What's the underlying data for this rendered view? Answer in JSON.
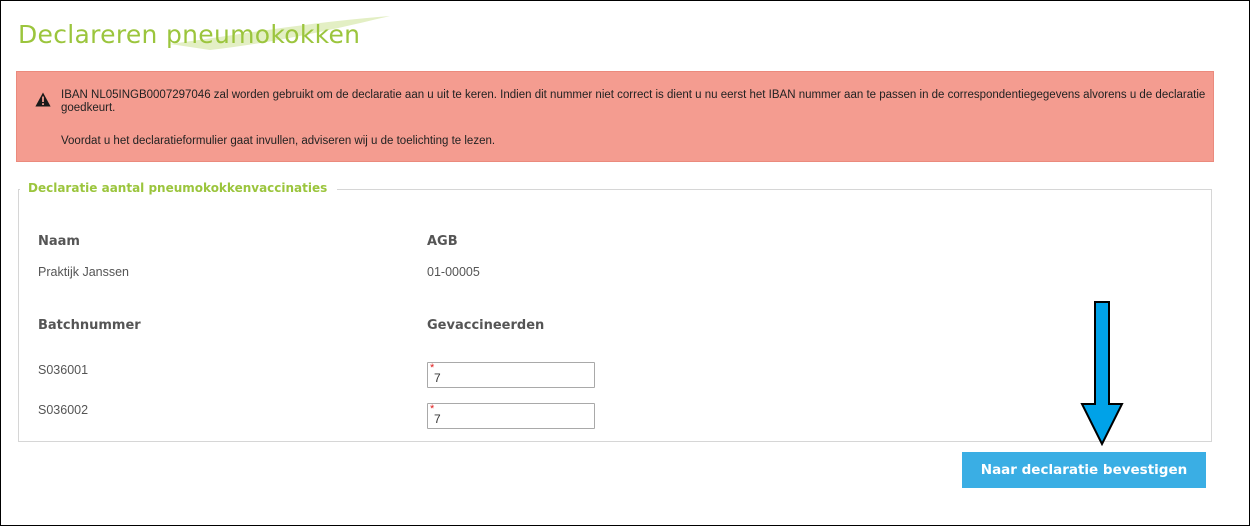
{
  "page": {
    "title": "Declareren pneumokokken"
  },
  "alert": {
    "icon": "warning-icon",
    "message": "IBAN NL05INGB0007297046 zal worden gebruikt om de declaratie aan u uit te keren. Indien dit nummer niet correct is dient u nu eerst het IBAN nummer aan te passen in de correspondentiegegevens alvorens u de declaratie goedkeurt.",
    "advice": "Voordat u het declaratieformulier gaat invullen, adviseren wij u de toelichting te lezen.",
    "background": "#f49c90"
  },
  "form": {
    "legend": "Declaratie aantal pneumokokkenvaccinaties",
    "name_label": "Naam",
    "name_value": "Praktijk Janssen",
    "agb_label": "AGB",
    "agb_value": "01-00005",
    "batch_label": "Batchnummer",
    "vaccinated_label": "Gevaccineerden",
    "required_marker": "*",
    "rows": [
      {
        "batch": "S036001",
        "vaccinated": "7"
      },
      {
        "batch": "S036002",
        "vaccinated": "7"
      }
    ]
  },
  "actions": {
    "confirm_label": "Naar declaratie bevestigen",
    "confirm_color": "#3aaee4"
  },
  "annotation": {
    "icon": "arrow-down-icon",
    "color": "#00a2e8"
  },
  "colors": {
    "accent_green": "#9bc53d"
  }
}
